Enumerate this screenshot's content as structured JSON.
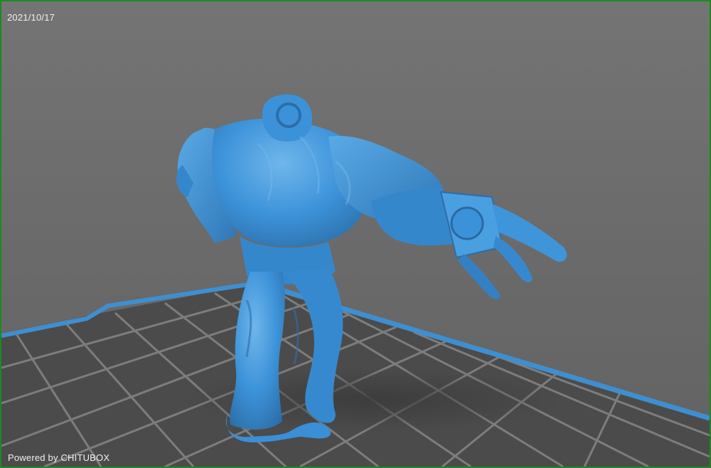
{
  "viewport": {
    "date": "2021/10/17",
    "watermark": "Powered by CHITUBOX"
  },
  "colors": {
    "background": "#6e6e6e",
    "frame": "#1e8a1e",
    "plate": "#4a4a4a",
    "grid": "#7c7c7c",
    "plate_edge": "#3e8fd1",
    "model": "#3c92d8",
    "model_shadow": "#2c6ea8",
    "model_highlight": "#6fb6ec"
  }
}
